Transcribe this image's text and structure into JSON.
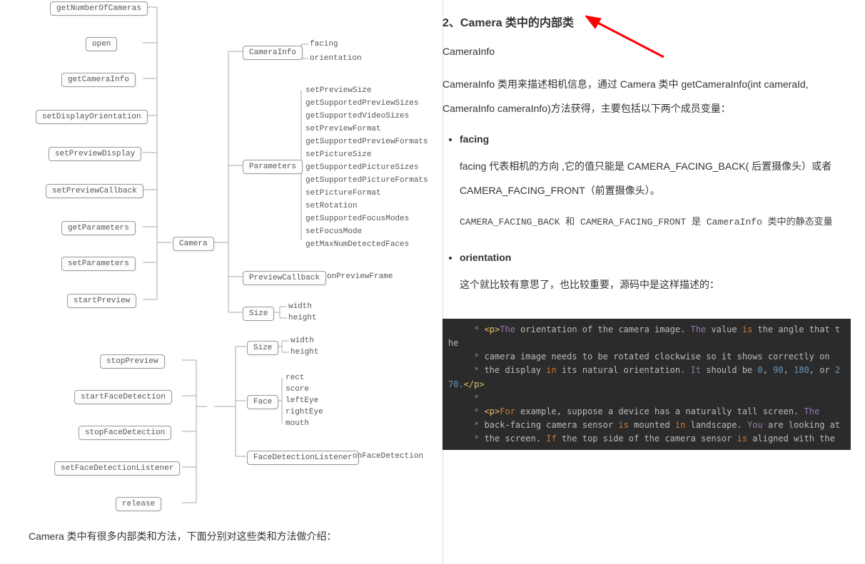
{
  "diagram": {
    "root": "Camera",
    "set1_methods": [
      "getNumberOfCameras",
      "open",
      "getCameraInfo",
      "setDisplayOrientation",
      "setPreviewDisplay",
      "setPreviewCallback",
      "getParameters",
      "setParameters",
      "startPreview"
    ],
    "set1_classes": {
      "CameraInfo": [
        "facing",
        "orientation"
      ],
      "Parameters": [
        "setPreviewSize",
        "getSupportedPreviewSizes",
        "getSupportedVideoSizes",
        "setPreviewFormat",
        "getSupportedPreviewFormats",
        "setPictureSize",
        "getSupportedPictureSizes",
        "getSupportedPictureFormats",
        "setPictureFormat",
        "setRotation",
        "getSupportedFocusModes",
        "setFocusMode",
        "getMaxNumDetectedFaces"
      ],
      "PreviewCallback": [
        "onPreviewFrame"
      ],
      "Size": [
        "width",
        "height"
      ]
    },
    "set2_methods": [
      "stopPreview",
      "startFaceDetection",
      "stopFaceDetection",
      "setFaceDetectionListener",
      "release"
    ],
    "set2_classes": {
      "Size": [
        "width",
        "height"
      ],
      "Face": [
        "rect",
        "score",
        "leftEye",
        "rightEye",
        "mouth"
      ],
      "FaceDetectionListener": [
        "onFaceDetection"
      ]
    }
  },
  "left_caption": "Camera 类中有很多内部类和方法，下面分别对这些类和方法做介绍：",
  "right": {
    "heading": "2、Camera 类中的内部类",
    "sub": "CameraInfo",
    "p1": "CameraInfo 类用来描述相机信息，通过 Camera 类中 getCameraInfo(int cameraId, CameraInfo cameraInfo)方法获得，主要包括以下两个成员变量：",
    "items": [
      {
        "title": "facing",
        "body": "facing  代表相机的方向 ,它的值只能是 CAMERA_FACING_BACK( 后置摄像头）或者 CAMERA_FACING_FRONT（前置摄像头）。",
        "note": "CAMERA_FACING_BACK 和 CAMERA_FACING_FRONT 是 CameraInfo 类中的静态变量"
      },
      {
        "title": "orientation",
        "body": "这个就比较有意思了，也比较重要，源码中是这样描述的："
      }
    ],
    "code": [
      {
        "t": "     * <p>The orientation of the camera image. The value is the angle that the"
      },
      {
        "t": "     * camera image needs to be rotated clockwise so it shows correctly on"
      },
      {
        "t": "     * the display in its natural orientation. It should be 0, 90, 180, or 270.</p>"
      },
      {
        "t": "     *"
      },
      {
        "t": "     * <p>For example, suppose a device has a naturally tall screen. The"
      },
      {
        "t": "     * back-facing camera sensor is mounted in landscape. You are looking at"
      },
      {
        "t": "     * the screen. If the top side of the camera sensor is aligned with the"
      }
    ]
  },
  "chart_data": {
    "type": "diagram",
    "title": "Camera class hierarchy",
    "root": "Camera",
    "children_methods_group1": [
      "getNumberOfCameras",
      "open",
      "getCameraInfo",
      "setDisplayOrientation",
      "setPreviewDisplay",
      "setPreviewCallback",
      "getParameters",
      "setParameters",
      "startPreview"
    ],
    "children_classes_group1": [
      {
        "name": "CameraInfo",
        "members": [
          "facing",
          "orientation"
        ]
      },
      {
        "name": "Parameters",
        "members": [
          "setPreviewSize",
          "getSupportedPreviewSizes",
          "getSupportedVideoSizes",
          "setPreviewFormat",
          "getSupportedPreviewFormats",
          "setPictureSize",
          "getSupportedPictureSizes",
          "getSupportedPictureFormats",
          "setPictureFormat",
          "setRotation",
          "getSupportedFocusModes",
          "setFocusMode",
          "getMaxNumDetectedFaces"
        ]
      },
      {
        "name": "PreviewCallback",
        "members": [
          "onPreviewFrame"
        ]
      },
      {
        "name": "Size",
        "members": [
          "width",
          "height"
        ]
      }
    ],
    "children_methods_group2": [
      "stopPreview",
      "startFaceDetection",
      "stopFaceDetection",
      "setFaceDetectionListener",
      "release"
    ],
    "children_classes_group2": [
      {
        "name": "Size",
        "members": [
          "width",
          "height"
        ]
      },
      {
        "name": "Face",
        "members": [
          "rect",
          "score",
          "leftEye",
          "rightEye",
          "mouth"
        ]
      },
      {
        "name": "FaceDetectionListener",
        "members": [
          "onFaceDetection"
        ]
      }
    ]
  }
}
